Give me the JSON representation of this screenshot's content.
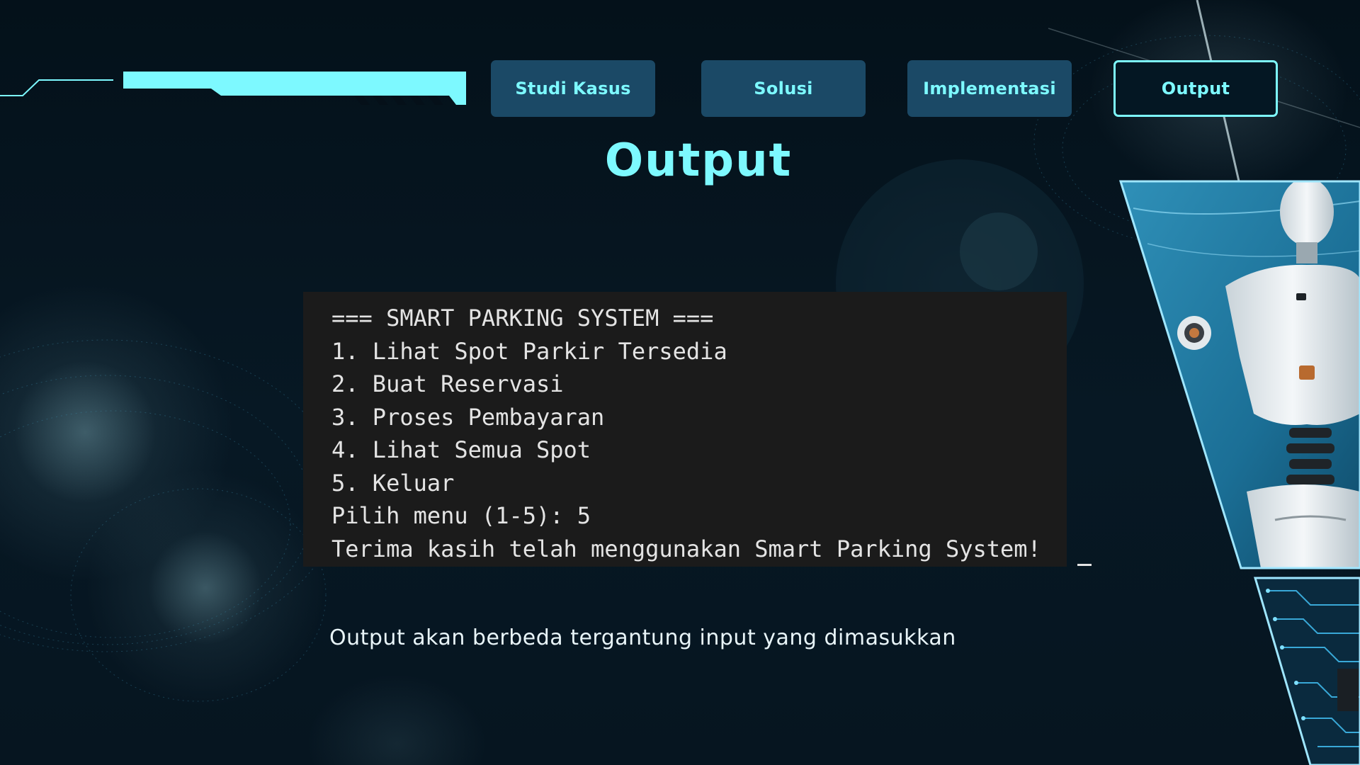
{
  "nav": {
    "tabs": [
      {
        "label": "Studi Kasus",
        "active": false
      },
      {
        "label": "Solusi",
        "active": false
      },
      {
        "label": "Implementasi",
        "active": false
      },
      {
        "label": "Output",
        "active": true
      }
    ]
  },
  "title": "Output",
  "terminal": {
    "lines": [
      "=== SMART PARKING SYSTEM ===",
      "1. Lihat Spot Parkir Tersedia",
      "2. Buat Reservasi",
      "3. Proses Pembayaran",
      "4. Lihat Semua Spot",
      "5. Keluar",
      "Pilih menu (1-5): 5",
      "Terima kasih telah menggunakan Smart Parking System!"
    ]
  },
  "caption": "Output akan berbeda tergantung input yang dimasukkan",
  "colors": {
    "accent": "#7df9ff",
    "tab_bg": "#1b4966",
    "background": "#051019",
    "terminal_bg": "#1b1b1b"
  },
  "icons": [
    "robot-image",
    "circuit-board-image",
    "header-bar-decoration"
  ]
}
